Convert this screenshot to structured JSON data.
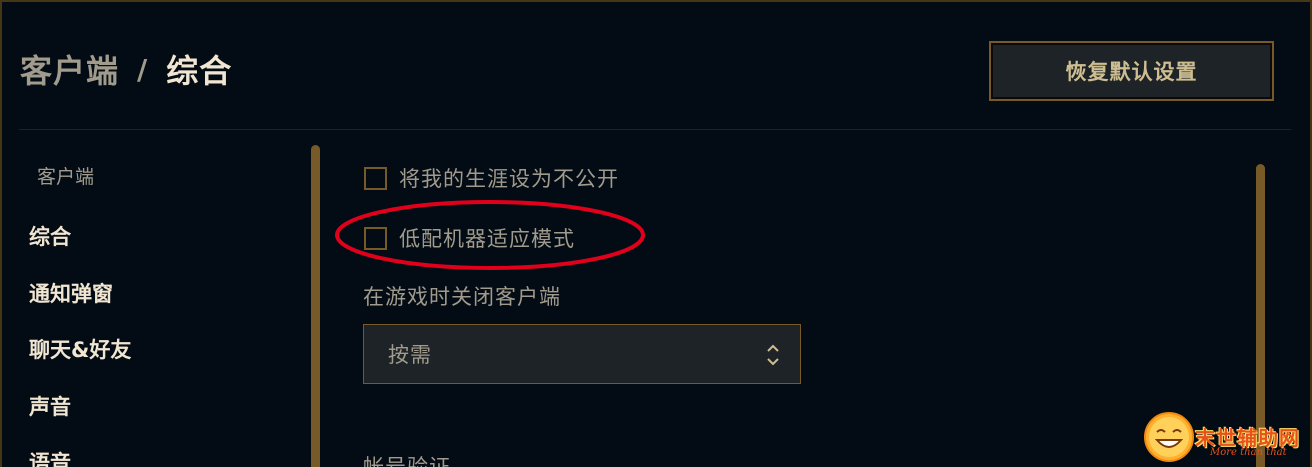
{
  "header": {
    "breadcrumb_parent": "客户端",
    "breadcrumb_separator": "/",
    "breadcrumb_current": "综合",
    "reset_button_label": "恢复默认设置"
  },
  "sidebar": {
    "section_title": "客户端",
    "items": [
      {
        "label": "综合"
      },
      {
        "label": "通知弹窗"
      },
      {
        "label": "聊天&好友"
      },
      {
        "label": "声音"
      },
      {
        "label": "语音"
      }
    ]
  },
  "settings": {
    "private_career_label": "将我的生涯设为不公开",
    "private_career_checked": false,
    "low_spec_label": "低配机器适应模式",
    "low_spec_checked": false,
    "close_client_label": "在游戏时关闭客户端",
    "close_client_value": "按需",
    "account_verify_label": "帐号验证"
  },
  "annotation": {
    "highlight_color": "#e0001b"
  },
  "watermark": {
    "title": "末世辅助网",
    "subtitle": "More than that"
  },
  "colors": {
    "gold": "#785a28",
    "background": "#010a13",
    "text_light": "#f0e6d2",
    "text_muted": "#a09b8c"
  }
}
